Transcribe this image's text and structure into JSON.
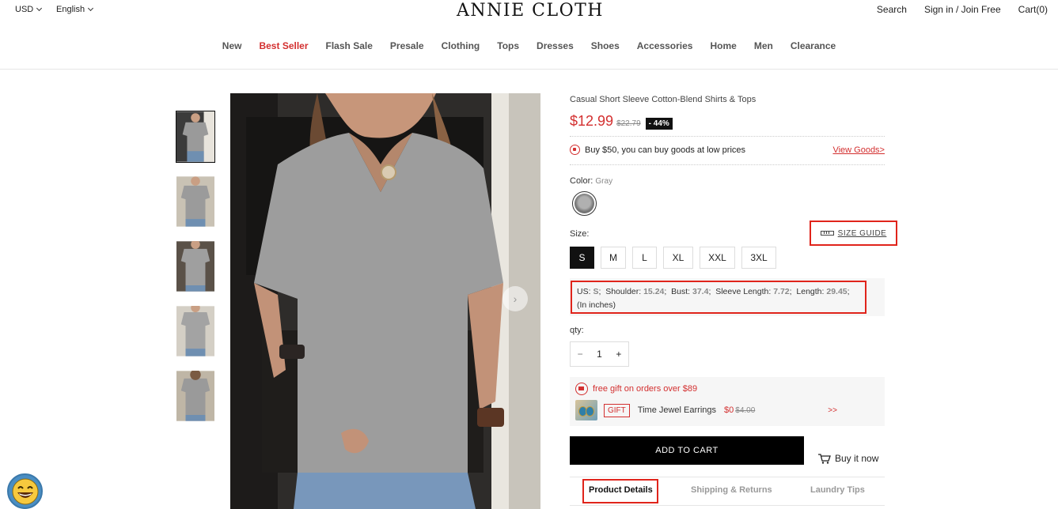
{
  "topbar": {
    "currency": "USD",
    "language": "English",
    "logo": "ANNIE CLOTH",
    "search": "Search",
    "signin": "Sign in / Join Free",
    "cart": "Cart(0)"
  },
  "nav": [
    "New",
    "Best Seller",
    "Flash Sale",
    "Presale",
    "Clothing",
    "Tops",
    "Dresses",
    "Shoes",
    "Accessories",
    "Home",
    "Men",
    "Clearance"
  ],
  "nav_active": "Best Seller",
  "product": {
    "title": "Casual Short Sleeve Cotton-Blend Shirts & Tops",
    "price": "$12.99",
    "old_price": "$22.79",
    "discount": "- 44%",
    "promo_text": "Buy $50, you can buy goods at low prices",
    "promo_link": "View Goods>",
    "color_label": "Color:",
    "color_value": "Gray",
    "size_label": "Size:",
    "size_guide": "SIZE GUIDE",
    "sizes": [
      "S",
      "M",
      "L",
      "XL",
      "XXL",
      "3XL"
    ],
    "selected_size": "S",
    "measurements": {
      "us_label": "US:",
      "us": "S",
      "shoulder_label": "Shoulder:",
      "shoulder": "15.24",
      "bust_label": "Bust:",
      "bust": "37.4",
      "sleeve_label": "Sleeve Length:",
      "sleeve": "7.72",
      "length_label": "Length:",
      "length": "29.45",
      "unit": "(In inches)"
    },
    "qty_label": "qty:",
    "qty_minus": "−",
    "qty": "1",
    "qty_plus": "+",
    "gift_text": "free gift on orders over $89",
    "gift_tag": "GIFT",
    "gift_name": "Time Jewel Earrings",
    "gift_price": "$0",
    "gift_old_price": "$4.00",
    "gift_more": ">>",
    "add_to_cart": "ADD TO CART",
    "buy_now": "Buy it now"
  },
  "tabs": [
    "Product Details",
    "Shipping & Returns",
    "Laundry Tips"
  ],
  "colors": {
    "accent": "#d32f2f",
    "highlight_box": "#e0241b"
  }
}
